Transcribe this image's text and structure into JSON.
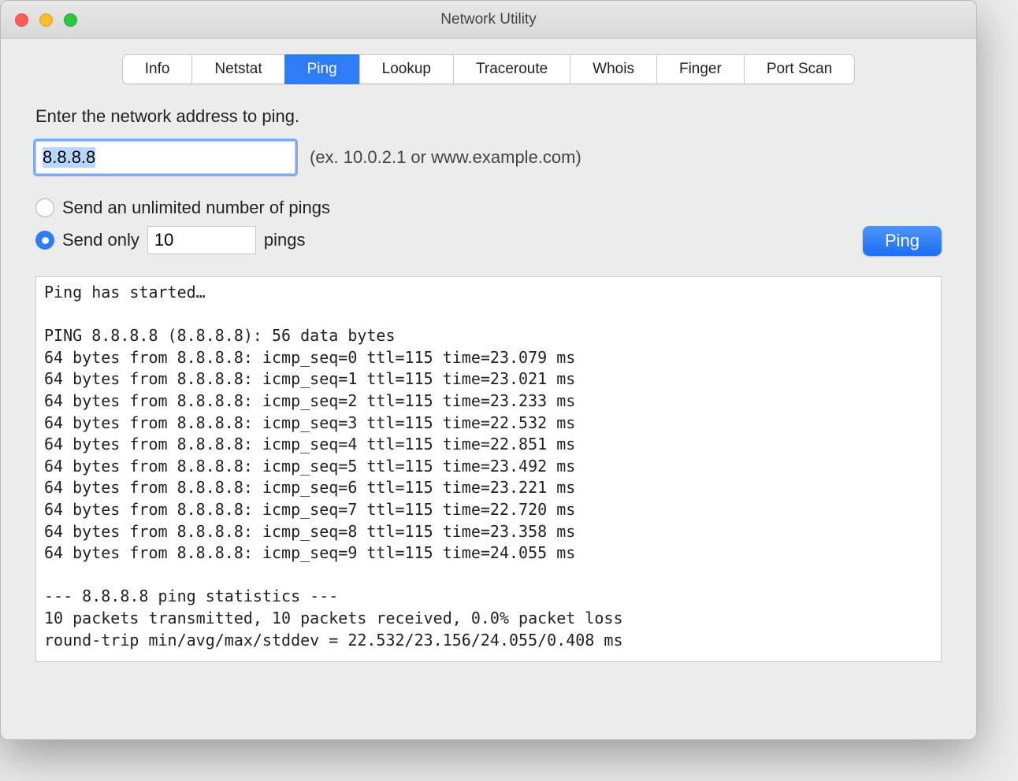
{
  "window": {
    "title": "Network Utility"
  },
  "tabs": [
    {
      "label": "Info",
      "active": false
    },
    {
      "label": "Netstat",
      "active": false
    },
    {
      "label": "Ping",
      "active": true
    },
    {
      "label": "Lookup",
      "active": false
    },
    {
      "label": "Traceroute",
      "active": false
    },
    {
      "label": "Whois",
      "active": false
    },
    {
      "label": "Finger",
      "active": false
    },
    {
      "label": "Port Scan",
      "active": false
    }
  ],
  "form": {
    "prompt": "Enter the network address to ping.",
    "address_value": "8.8.8.8",
    "address_hint": "(ex. 10.0.2.1 or www.example.com)",
    "radio_unlimited_label": "Send an unlimited number of pings",
    "radio_sendonly_prefix": "Send only",
    "radio_sendonly_suffix": "pings",
    "count_value": "10",
    "selected_option": "send_only",
    "ping_button": "Ping"
  },
  "output_text": "Ping has started…\n\nPING 8.8.8.8 (8.8.8.8): 56 data bytes\n64 bytes from 8.8.8.8: icmp_seq=0 ttl=115 time=23.079 ms\n64 bytes from 8.8.8.8: icmp_seq=1 ttl=115 time=23.021 ms\n64 bytes from 8.8.8.8: icmp_seq=2 ttl=115 time=23.233 ms\n64 bytes from 8.8.8.8: icmp_seq=3 ttl=115 time=22.532 ms\n64 bytes from 8.8.8.8: icmp_seq=4 ttl=115 time=22.851 ms\n64 bytes from 8.8.8.8: icmp_seq=5 ttl=115 time=23.492 ms\n64 bytes from 8.8.8.8: icmp_seq=6 ttl=115 time=23.221 ms\n64 bytes from 8.8.8.8: icmp_seq=7 ttl=115 time=22.720 ms\n64 bytes from 8.8.8.8: icmp_seq=8 ttl=115 time=23.358 ms\n64 bytes from 8.8.8.8: icmp_seq=9 ttl=115 time=24.055 ms\n\n--- 8.8.8.8 ping statistics ---\n10 packets transmitted, 10 packets received, 0.0% packet loss\nround-trip min/avg/max/stddev = 22.532/23.156/24.055/0.408 ms"
}
